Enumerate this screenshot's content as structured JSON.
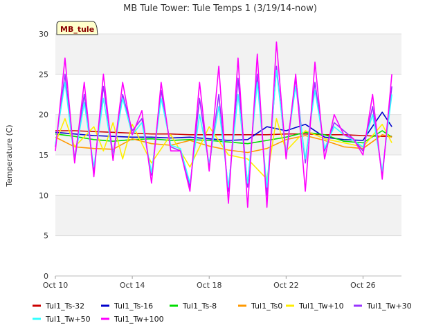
{
  "chart_data": {
    "type": "line",
    "title": "MB Tule Tower: Tule Temps 1 (3/19/14-now)",
    "ylabel": "Temperature (C)",
    "xlabel": "",
    "badge": "MB_tule",
    "ylim": [
      0,
      30
    ],
    "yticks": [
      0,
      5,
      10,
      15,
      20,
      25,
      30
    ],
    "xlim": [
      "2014-10-10",
      "2014-10-28"
    ],
    "xticks": [
      {
        "date": "2014-10-10",
        "label": "Oct 10"
      },
      {
        "date": "2014-10-14",
        "label": "Oct 14"
      },
      {
        "date": "2014-10-18",
        "label": "Oct 18"
      },
      {
        "date": "2014-10-22",
        "label": "Oct 22"
      },
      {
        "date": "2014-10-26",
        "label": "Oct 26"
      }
    ],
    "grid": true,
    "legend_position": "bottom",
    "series": [
      {
        "name": "Tul1_Ts-32",
        "color": "#cc0000",
        "x": [
          "2014-10-10",
          "2014-10-11",
          "2014-10-12",
          "2014-10-13",
          "2014-10-14",
          "2014-10-15",
          "2014-10-16",
          "2014-10-17",
          "2014-10-18",
          "2014-10-19",
          "2014-10-20",
          "2014-10-21",
          "2014-10-22",
          "2014-10-23",
          "2014-10-24",
          "2014-10-25",
          "2014-10-26",
          "2014-10-27",
          "2014-10-27 12:00"
        ],
        "values": [
          18.0,
          18.0,
          17.9,
          17.8,
          17.7,
          17.6,
          17.6,
          17.5,
          17.5,
          17.5,
          17.5,
          17.5,
          17.6,
          17.6,
          17.5,
          17.5,
          17.4,
          17.3,
          17.3
        ]
      },
      {
        "name": "Tul1_Ts-16",
        "color": "#0000cc",
        "x": [
          "2014-10-10",
          "2014-10-11",
          "2014-10-12",
          "2014-10-13",
          "2014-10-14",
          "2014-10-15",
          "2014-10-16",
          "2014-10-17",
          "2014-10-18",
          "2014-10-19",
          "2014-10-20",
          "2014-10-21",
          "2014-10-22",
          "2014-10-23",
          "2014-10-24",
          "2014-10-25",
          "2014-10-26",
          "2014-10-27",
          "2014-10-27 12:00"
        ],
        "values": [
          17.8,
          17.6,
          17.4,
          17.3,
          17.2,
          17.2,
          17.1,
          17.2,
          17.0,
          16.8,
          16.9,
          18.5,
          18.0,
          18.8,
          17.2,
          16.9,
          16.8,
          20.3,
          18.5
        ]
      },
      {
        "name": "Tul1_Ts-8",
        "color": "#00dd00",
        "x": [
          "2014-10-10",
          "2014-10-11",
          "2014-10-12",
          "2014-10-13",
          "2014-10-14",
          "2014-10-15",
          "2014-10-16",
          "2014-10-17",
          "2014-10-18",
          "2014-10-19",
          "2014-10-20",
          "2014-10-21",
          "2014-10-22",
          "2014-10-23",
          "2014-10-24",
          "2014-10-25",
          "2014-10-26",
          "2014-10-27",
          "2014-10-27 12:00"
        ],
        "values": [
          17.6,
          17.3,
          16.9,
          16.7,
          16.9,
          17.0,
          16.8,
          16.9,
          16.8,
          16.6,
          16.4,
          16.8,
          17.2,
          17.8,
          17.5,
          16.7,
          16.5,
          18.0,
          17.2
        ]
      },
      {
        "name": "Tul1_Ts0",
        "color": "#ff9900",
        "x": [
          "2014-10-10",
          "2014-10-11",
          "2014-10-12",
          "2014-10-13",
          "2014-10-14",
          "2014-10-15",
          "2014-10-16",
          "2014-10-17",
          "2014-10-18",
          "2014-10-19",
          "2014-10-20",
          "2014-10-21",
          "2014-10-22",
          "2014-10-23",
          "2014-10-24",
          "2014-10-25",
          "2014-10-26",
          "2014-10-27",
          "2014-10-27 12:00"
        ],
        "values": [
          17.2,
          16.0,
          15.8,
          15.7,
          17.0,
          16.4,
          16.2,
          16.8,
          16.1,
          15.6,
          15.3,
          15.8,
          16.9,
          17.4,
          16.8,
          16.0,
          15.8,
          17.5,
          17.2
        ]
      },
      {
        "name": "Tul1_Tw+10",
        "color": "#ffee00",
        "x": [
          "2014-10-10",
          "2014-10-10 12:00",
          "2014-10-11",
          "2014-10-12",
          "2014-10-12 12:00",
          "2014-10-13",
          "2014-10-13 12:00",
          "2014-10-14",
          "2014-10-15",
          "2014-10-16",
          "2014-10-17",
          "2014-10-18",
          "2014-10-19",
          "2014-10-20",
          "2014-10-21",
          "2014-10-21 12:00",
          "2014-10-22",
          "2014-10-23",
          "2014-10-24",
          "2014-10-25",
          "2014-10-26",
          "2014-10-27",
          "2014-10-27 12:00"
        ],
        "values": [
          16.5,
          19.5,
          16.0,
          18.5,
          15.5,
          19.0,
          14.5,
          18.8,
          14.0,
          17.5,
          13.5,
          18.5,
          15.0,
          14.5,
          12.0,
          19.5,
          15.5,
          18.0,
          17.0,
          16.5,
          16.0,
          18.8,
          16.5
        ]
      },
      {
        "name": "Tul1_Tw+30",
        "color": "#9933ff",
        "x": [
          "2014-10-10",
          "2014-10-10 12:00",
          "2014-10-11",
          "2014-10-11 12:00",
          "2014-10-12",
          "2014-10-12 12:00",
          "2014-10-13",
          "2014-10-13 12:00",
          "2014-10-14",
          "2014-10-14 12:00",
          "2014-10-15",
          "2014-10-15 12:00",
          "2014-10-16",
          "2014-10-16 12:00",
          "2014-10-17",
          "2014-10-17 12:00",
          "2014-10-18",
          "2014-10-18 12:00",
          "2014-10-19",
          "2014-10-19 12:00",
          "2014-10-20",
          "2014-10-20 12:00",
          "2014-10-21",
          "2014-10-21 12:00",
          "2014-10-22",
          "2014-10-22 12:00",
          "2014-10-23",
          "2014-10-23 12:00",
          "2014-10-24",
          "2014-10-24 12:00",
          "2014-10-25",
          "2014-10-25 12:00",
          "2014-10-26",
          "2014-10-26 12:00",
          "2014-10-27",
          "2014-10-27 12:00"
        ],
        "values": [
          16.0,
          25.0,
          14.5,
          22.5,
          13.0,
          23.5,
          15.0,
          22.5,
          18.0,
          19.5,
          12.5,
          23.0,
          16.0,
          15.5,
          11.0,
          22.0,
          13.5,
          22.5,
          10.5,
          24.5,
          11.0,
          25.0,
          10.0,
          26.0,
          15.0,
          24.5,
          14.0,
          24.0,
          15.5,
          19.0,
          18.0,
          17.0,
          15.5,
          21.0,
          12.5,
          23.5
        ]
      },
      {
        "name": "Tul1_Tw+50",
        "color": "#33ffff",
        "x": [
          "2014-10-10",
          "2014-10-10 12:00",
          "2014-10-11",
          "2014-10-11 12:00",
          "2014-10-12",
          "2014-10-12 12:00",
          "2014-10-13",
          "2014-10-13 12:00",
          "2014-10-14",
          "2014-10-14 12:00",
          "2014-10-15",
          "2014-10-15 12:00",
          "2014-10-16",
          "2014-10-16 12:00",
          "2014-10-17",
          "2014-10-17 12:00",
          "2014-10-18",
          "2014-10-18 12:00",
          "2014-10-19",
          "2014-10-19 12:00",
          "2014-10-20",
          "2014-10-20 12:00",
          "2014-10-21",
          "2014-10-21 12:00",
          "2014-10-22",
          "2014-10-22 12:00",
          "2014-10-23",
          "2014-10-23 12:00",
          "2014-10-24",
          "2014-10-24 12:00",
          "2014-10-25",
          "2014-10-25 12:00",
          "2014-10-26",
          "2014-10-26 12:00",
          "2014-10-27",
          "2014-10-27 12:00"
        ],
        "values": [
          16.3,
          24.0,
          14.3,
          21.5,
          13.5,
          22.0,
          14.8,
          22.0,
          17.5,
          19.0,
          12.8,
          22.0,
          16.2,
          15.8,
          11.5,
          20.0,
          14.0,
          21.0,
          11.0,
          22.5,
          11.5,
          24.0,
          11.0,
          25.5,
          15.2,
          23.5,
          14.5,
          23.0,
          15.8,
          18.5,
          17.5,
          16.8,
          16.0,
          20.0,
          13.0,
          22.5
        ]
      },
      {
        "name": "Tul1_Tw+100",
        "color": "#ff00ff",
        "x": [
          "2014-10-10",
          "2014-10-10 12:00",
          "2014-10-11",
          "2014-10-11 12:00",
          "2014-10-12",
          "2014-10-12 12:00",
          "2014-10-13",
          "2014-10-13 12:00",
          "2014-10-14",
          "2014-10-14 12:00",
          "2014-10-15",
          "2014-10-15 12:00",
          "2014-10-16",
          "2014-10-16 12:00",
          "2014-10-17",
          "2014-10-17 12:00",
          "2014-10-18",
          "2014-10-18 12:00",
          "2014-10-19",
          "2014-10-19 12:00",
          "2014-10-20",
          "2014-10-20 12:00",
          "2014-10-21",
          "2014-10-21 12:00",
          "2014-10-22",
          "2014-10-22 12:00",
          "2014-10-23",
          "2014-10-23 12:00",
          "2014-10-24",
          "2014-10-24 12:00",
          "2014-10-25",
          "2014-10-25 12:00",
          "2014-10-26",
          "2014-10-26 12:00",
          "2014-10-27",
          "2014-10-27 12:00"
        ],
        "values": [
          15.5,
          27.0,
          14.0,
          24.0,
          12.3,
          25.0,
          14.3,
          24.0,
          17.5,
          20.5,
          11.5,
          24.0,
          15.5,
          15.5,
          10.5,
          24.0,
          13.0,
          26.0,
          9.0,
          27.0,
          8.5,
          27.5,
          8.5,
          29.0,
          14.5,
          25.0,
          10.5,
          26.5,
          14.5,
          20.0,
          17.5,
          17.0,
          15.0,
          22.5,
          12.0,
          25.0
        ]
      }
    ]
  }
}
